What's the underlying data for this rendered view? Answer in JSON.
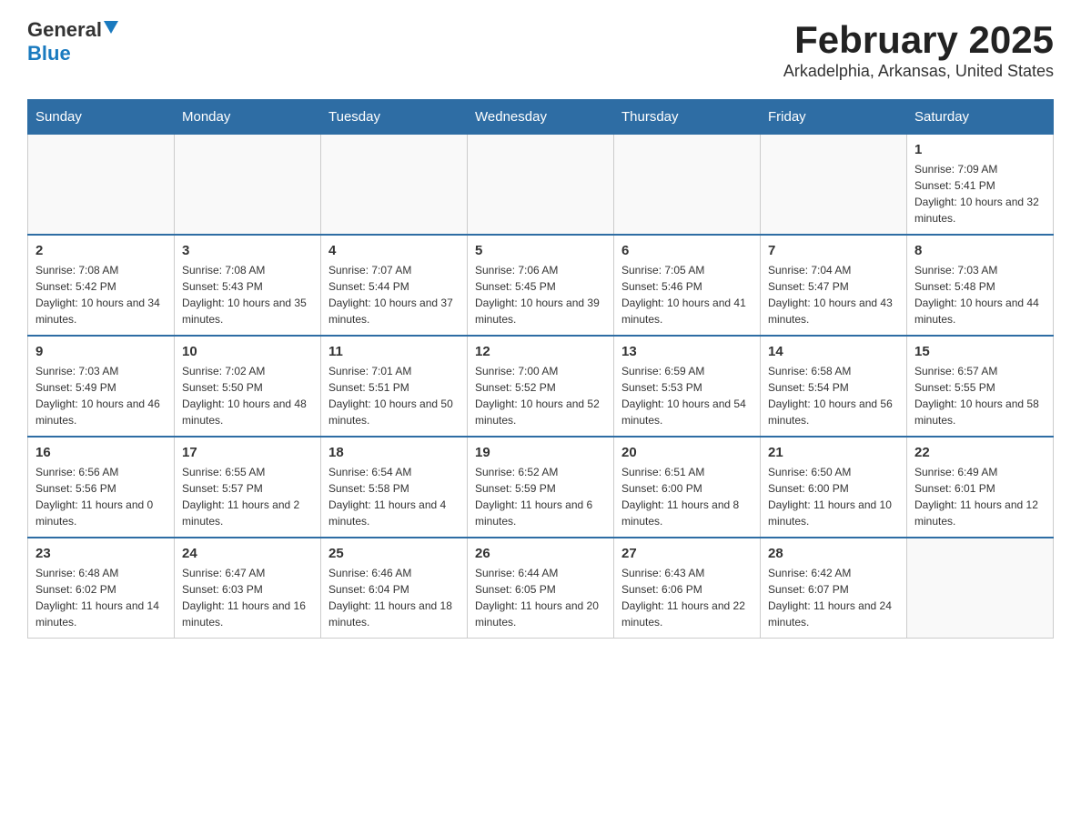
{
  "header": {
    "logo_general": "General",
    "logo_blue": "Blue",
    "title": "February 2025",
    "location": "Arkadelphia, Arkansas, United States"
  },
  "days_of_week": [
    "Sunday",
    "Monday",
    "Tuesday",
    "Wednesday",
    "Thursday",
    "Friday",
    "Saturday"
  ],
  "weeks": [
    [
      {
        "day": "",
        "sunrise": "",
        "sunset": "",
        "daylight": ""
      },
      {
        "day": "",
        "sunrise": "",
        "sunset": "",
        "daylight": ""
      },
      {
        "day": "",
        "sunrise": "",
        "sunset": "",
        "daylight": ""
      },
      {
        "day": "",
        "sunrise": "",
        "sunset": "",
        "daylight": ""
      },
      {
        "day": "",
        "sunrise": "",
        "sunset": "",
        "daylight": ""
      },
      {
        "day": "",
        "sunrise": "",
        "sunset": "",
        "daylight": ""
      },
      {
        "day": "1",
        "sunrise": "Sunrise: 7:09 AM",
        "sunset": "Sunset: 5:41 PM",
        "daylight": "Daylight: 10 hours and 32 minutes."
      }
    ],
    [
      {
        "day": "2",
        "sunrise": "Sunrise: 7:08 AM",
        "sunset": "Sunset: 5:42 PM",
        "daylight": "Daylight: 10 hours and 34 minutes."
      },
      {
        "day": "3",
        "sunrise": "Sunrise: 7:08 AM",
        "sunset": "Sunset: 5:43 PM",
        "daylight": "Daylight: 10 hours and 35 minutes."
      },
      {
        "day": "4",
        "sunrise": "Sunrise: 7:07 AM",
        "sunset": "Sunset: 5:44 PM",
        "daylight": "Daylight: 10 hours and 37 minutes."
      },
      {
        "day": "5",
        "sunrise": "Sunrise: 7:06 AM",
        "sunset": "Sunset: 5:45 PM",
        "daylight": "Daylight: 10 hours and 39 minutes."
      },
      {
        "day": "6",
        "sunrise": "Sunrise: 7:05 AM",
        "sunset": "Sunset: 5:46 PM",
        "daylight": "Daylight: 10 hours and 41 minutes."
      },
      {
        "day": "7",
        "sunrise": "Sunrise: 7:04 AM",
        "sunset": "Sunset: 5:47 PM",
        "daylight": "Daylight: 10 hours and 43 minutes."
      },
      {
        "day": "8",
        "sunrise": "Sunrise: 7:03 AM",
        "sunset": "Sunset: 5:48 PM",
        "daylight": "Daylight: 10 hours and 44 minutes."
      }
    ],
    [
      {
        "day": "9",
        "sunrise": "Sunrise: 7:03 AM",
        "sunset": "Sunset: 5:49 PM",
        "daylight": "Daylight: 10 hours and 46 minutes."
      },
      {
        "day": "10",
        "sunrise": "Sunrise: 7:02 AM",
        "sunset": "Sunset: 5:50 PM",
        "daylight": "Daylight: 10 hours and 48 minutes."
      },
      {
        "day": "11",
        "sunrise": "Sunrise: 7:01 AM",
        "sunset": "Sunset: 5:51 PM",
        "daylight": "Daylight: 10 hours and 50 minutes."
      },
      {
        "day": "12",
        "sunrise": "Sunrise: 7:00 AM",
        "sunset": "Sunset: 5:52 PM",
        "daylight": "Daylight: 10 hours and 52 minutes."
      },
      {
        "day": "13",
        "sunrise": "Sunrise: 6:59 AM",
        "sunset": "Sunset: 5:53 PM",
        "daylight": "Daylight: 10 hours and 54 minutes."
      },
      {
        "day": "14",
        "sunrise": "Sunrise: 6:58 AM",
        "sunset": "Sunset: 5:54 PM",
        "daylight": "Daylight: 10 hours and 56 minutes."
      },
      {
        "day": "15",
        "sunrise": "Sunrise: 6:57 AM",
        "sunset": "Sunset: 5:55 PM",
        "daylight": "Daylight: 10 hours and 58 minutes."
      }
    ],
    [
      {
        "day": "16",
        "sunrise": "Sunrise: 6:56 AM",
        "sunset": "Sunset: 5:56 PM",
        "daylight": "Daylight: 11 hours and 0 minutes."
      },
      {
        "day": "17",
        "sunrise": "Sunrise: 6:55 AM",
        "sunset": "Sunset: 5:57 PM",
        "daylight": "Daylight: 11 hours and 2 minutes."
      },
      {
        "day": "18",
        "sunrise": "Sunrise: 6:54 AM",
        "sunset": "Sunset: 5:58 PM",
        "daylight": "Daylight: 11 hours and 4 minutes."
      },
      {
        "day": "19",
        "sunrise": "Sunrise: 6:52 AM",
        "sunset": "Sunset: 5:59 PM",
        "daylight": "Daylight: 11 hours and 6 minutes."
      },
      {
        "day": "20",
        "sunrise": "Sunrise: 6:51 AM",
        "sunset": "Sunset: 6:00 PM",
        "daylight": "Daylight: 11 hours and 8 minutes."
      },
      {
        "day": "21",
        "sunrise": "Sunrise: 6:50 AM",
        "sunset": "Sunset: 6:00 PM",
        "daylight": "Daylight: 11 hours and 10 minutes."
      },
      {
        "day": "22",
        "sunrise": "Sunrise: 6:49 AM",
        "sunset": "Sunset: 6:01 PM",
        "daylight": "Daylight: 11 hours and 12 minutes."
      }
    ],
    [
      {
        "day": "23",
        "sunrise": "Sunrise: 6:48 AM",
        "sunset": "Sunset: 6:02 PM",
        "daylight": "Daylight: 11 hours and 14 minutes."
      },
      {
        "day": "24",
        "sunrise": "Sunrise: 6:47 AM",
        "sunset": "Sunset: 6:03 PM",
        "daylight": "Daylight: 11 hours and 16 minutes."
      },
      {
        "day": "25",
        "sunrise": "Sunrise: 6:46 AM",
        "sunset": "Sunset: 6:04 PM",
        "daylight": "Daylight: 11 hours and 18 minutes."
      },
      {
        "day": "26",
        "sunrise": "Sunrise: 6:44 AM",
        "sunset": "Sunset: 6:05 PM",
        "daylight": "Daylight: 11 hours and 20 minutes."
      },
      {
        "day": "27",
        "sunrise": "Sunrise: 6:43 AM",
        "sunset": "Sunset: 6:06 PM",
        "daylight": "Daylight: 11 hours and 22 minutes."
      },
      {
        "day": "28",
        "sunrise": "Sunrise: 6:42 AM",
        "sunset": "Sunset: 6:07 PM",
        "daylight": "Daylight: 11 hours and 24 minutes."
      },
      {
        "day": "",
        "sunrise": "",
        "sunset": "",
        "daylight": ""
      }
    ]
  ]
}
